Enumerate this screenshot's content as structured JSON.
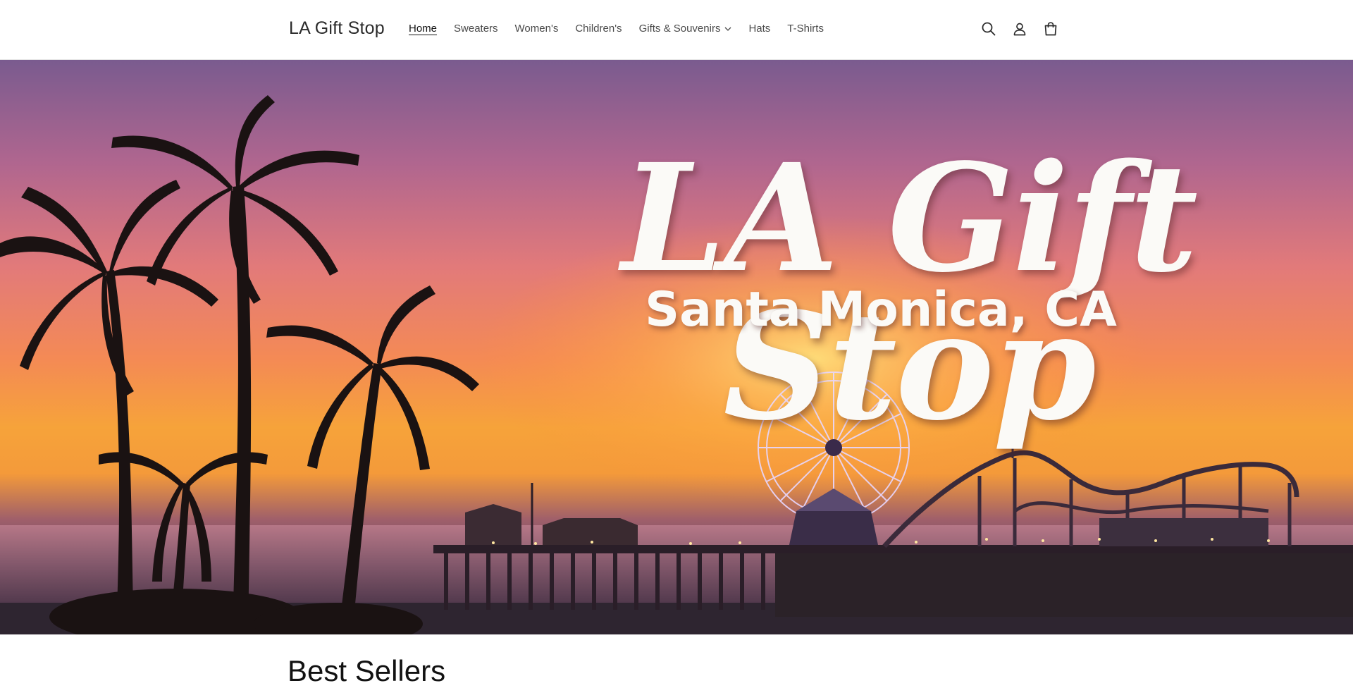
{
  "header": {
    "logo": "LA Gift Stop",
    "nav": [
      {
        "label": "Home",
        "active": true
      },
      {
        "label": "Sweaters"
      },
      {
        "label": "Women's"
      },
      {
        "label": "Children's"
      },
      {
        "label": "Gifts & Souvenirs",
        "dropdown": true
      },
      {
        "label": "Hats"
      },
      {
        "label": "T-Shirts"
      }
    ],
    "icons": [
      "search-icon",
      "account-icon",
      "cart-icon"
    ]
  },
  "hero": {
    "title": "LA Gift Stop",
    "subtitle": "Santa Monica, CA"
  },
  "section": {
    "title": "Best Sellers"
  }
}
